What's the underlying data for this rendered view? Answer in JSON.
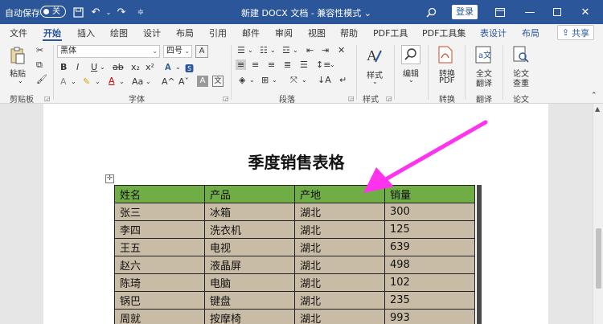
{
  "titlebar": {
    "autosave_label": "自动保存",
    "autosave_state": "关",
    "doc_title": "新建 DOCX 文档  -  兼容性模式 ⌄",
    "login_label": "登录"
  },
  "tabs": [
    "文件",
    "开始",
    "插入",
    "绘图",
    "设计",
    "布局",
    "引用",
    "邮件",
    "审阅",
    "视图",
    "帮助",
    "PDF工具",
    "PDF工具集",
    "表设计",
    "布局"
  ],
  "share_label": "共享",
  "ribbon": {
    "clipboard": {
      "paste_label": "粘贴",
      "group_label": "剪贴板"
    },
    "font": {
      "font_name": "黑体",
      "font_size": "四号",
      "group_label": "字体",
      "bold": "B",
      "italic": "I",
      "underline": "U",
      "strike": "ab",
      "subscript": "x₂",
      "superscript": "x²",
      "aa_label": "Aa",
      "grow": "A^",
      "shrink": "Aˇ",
      "wen": "文",
      "char_a": "A"
    },
    "paragraph": {
      "group_label": "段落"
    },
    "styles": {
      "label": "样式",
      "group_label": "样式"
    },
    "editing": {
      "label": "编辑"
    },
    "convert": {
      "label": "转换\nPDF",
      "label1": "转换",
      "label2": "PDF",
      "group_label": "转换"
    },
    "translate": {
      "label1": "全文",
      "label2": "翻译",
      "group_label": "翻译"
    },
    "paper": {
      "label1": "论文",
      "label2": "查重",
      "group_label": "论文"
    }
  },
  "document": {
    "title": "季度销售表格",
    "table": {
      "headers": [
        "姓名",
        "产品",
        "产地",
        "销量"
      ],
      "rows": [
        [
          "张三",
          "冰箱",
          "湖北",
          "300"
        ],
        [
          "李四",
          "洗衣机",
          "湖北",
          "125"
        ],
        [
          "王五",
          "电视",
          "湖北",
          "639"
        ],
        [
          "赵六",
          "液晶屏",
          "湖北",
          "498"
        ],
        [
          "陈琦",
          "电脑",
          "湖北",
          "102"
        ],
        [
          "锅巴",
          "键盘",
          "湖北",
          "235"
        ],
        [
          "周就",
          "按摩椅",
          "湖北",
          "993"
        ]
      ]
    }
  },
  "colors": {
    "titlebar": "#2b579a",
    "header_row": "#70ad47",
    "body_row": "#c9bca6",
    "annotation_arrow": "#ff33ee"
  }
}
